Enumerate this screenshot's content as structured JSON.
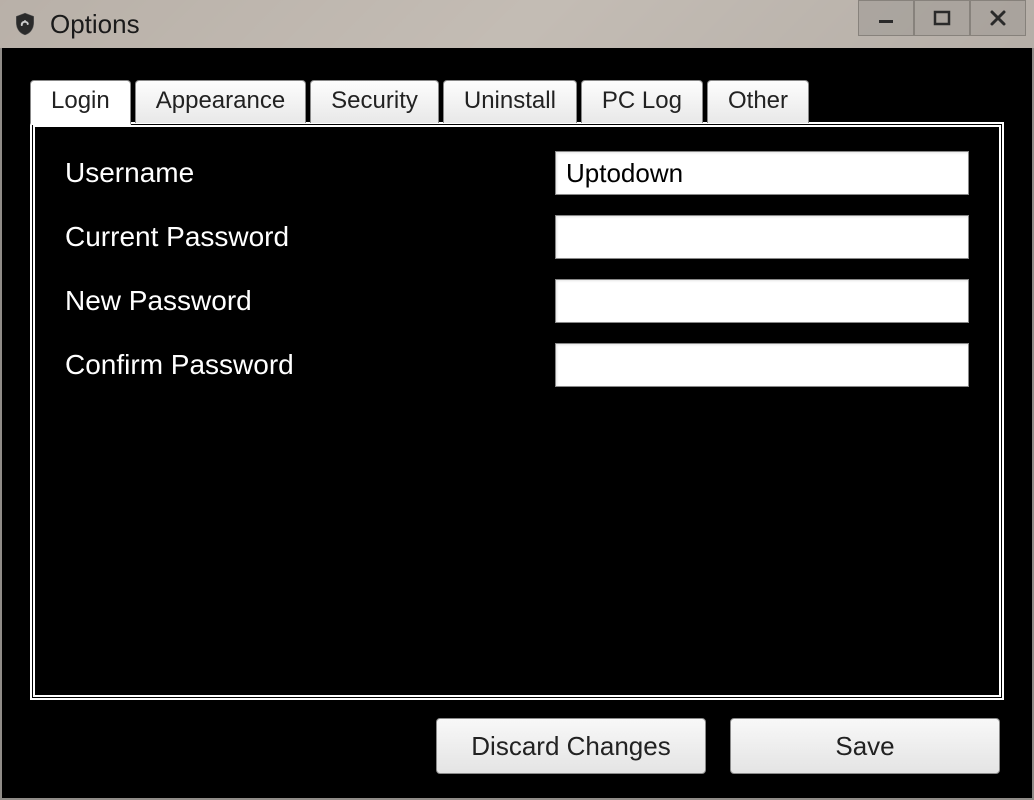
{
  "window": {
    "title": "Options"
  },
  "tabs": {
    "login": "Login",
    "appearance": "Appearance",
    "security": "Security",
    "uninstall": "Uninstall",
    "pclog": "PC Log",
    "other": "Other"
  },
  "form": {
    "username_label": "Username",
    "username_value": "Uptodown",
    "current_password_label": "Current Password",
    "current_password_value": "",
    "new_password_label": "New Password",
    "new_password_value": "",
    "confirm_password_label": "Confirm Password",
    "confirm_password_value": ""
  },
  "buttons": {
    "discard": "Discard Changes",
    "save": "Save"
  }
}
